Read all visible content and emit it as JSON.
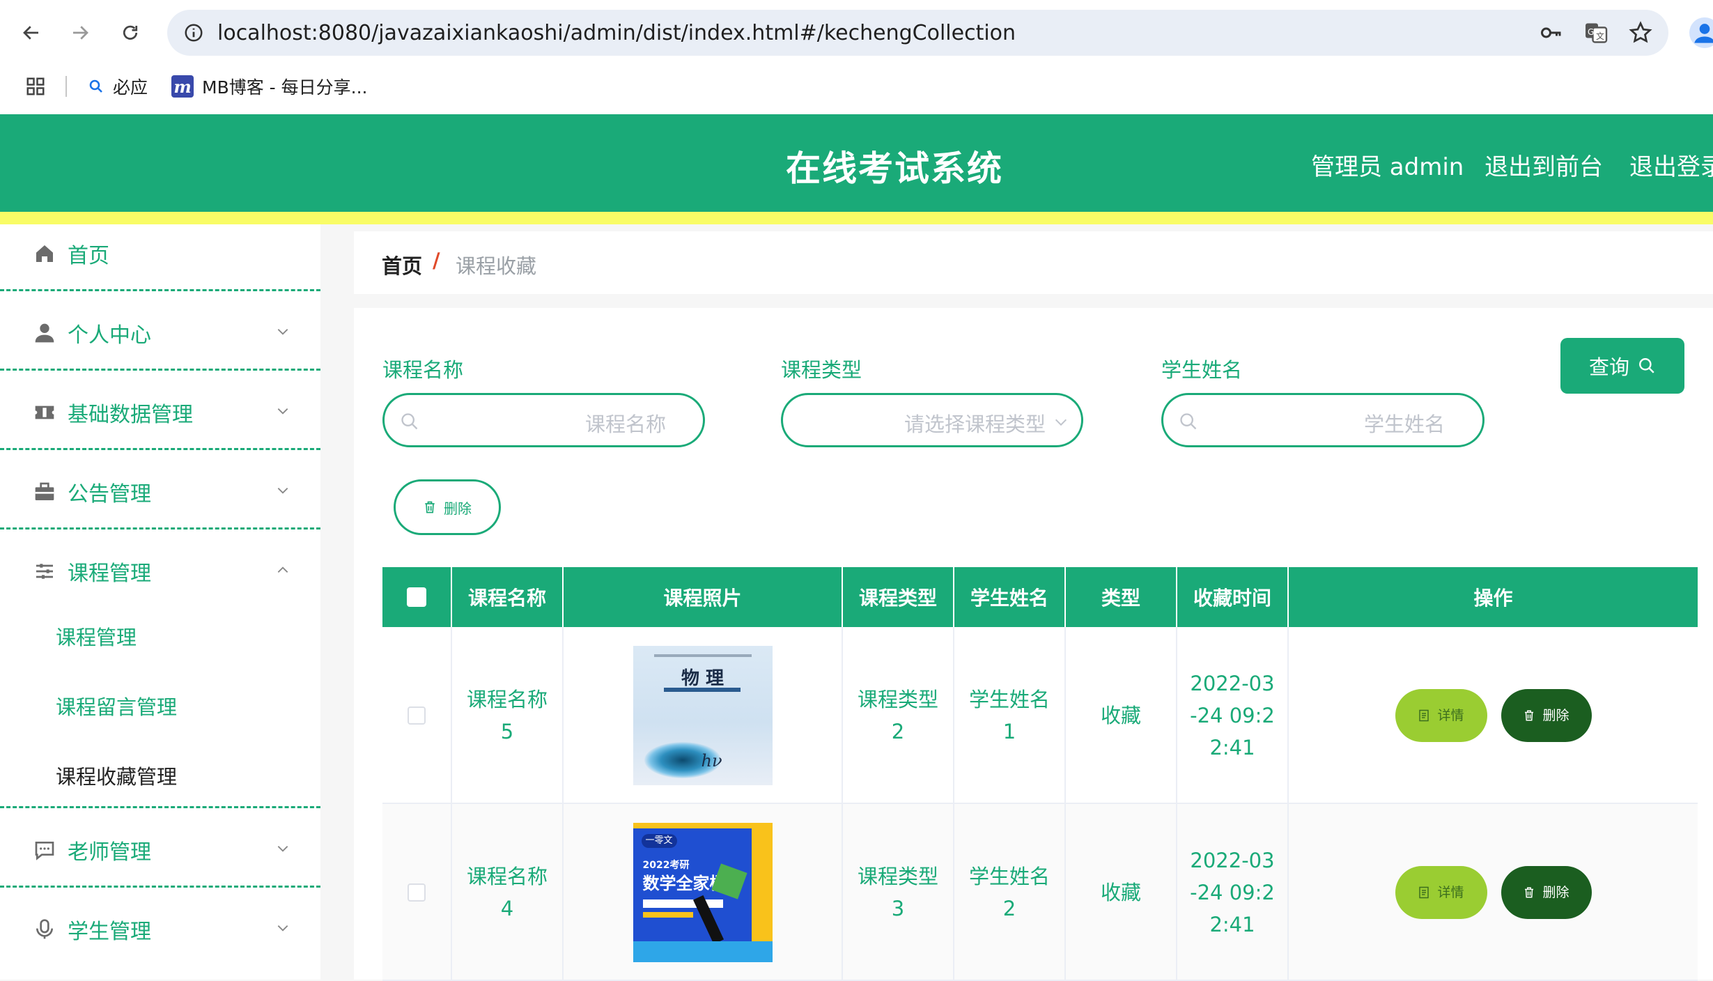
{
  "browser": {
    "url": "localhost:8080/javazaixiankaoshi/admin/dist/index.html#/kechengCollection",
    "bookmarks": [
      {
        "label": "必应",
        "icon": "search-icon"
      },
      {
        "label": "MB博客 - 每日分享...",
        "icon": "mb-logo-icon"
      }
    ]
  },
  "header": {
    "title": "在线考试系统",
    "user_label": "管理员 admin",
    "to_front_label": "退出到前台",
    "logout_label": "退出登录"
  },
  "colors": {
    "primary": "#1aaa78",
    "accent_line": "#f9fc66",
    "detail_button": "#9acd32",
    "delete_button": "#1b5e20"
  },
  "sidebar": {
    "items": [
      {
        "label": "首页",
        "icon": "home-icon"
      },
      {
        "label": "个人中心",
        "icon": "user-icon"
      },
      {
        "label": "基础数据管理",
        "icon": "ticket-icon"
      },
      {
        "label": "公告管理",
        "icon": "briefcase-icon"
      },
      {
        "label": "课程管理",
        "icon": "sliders-icon",
        "expanded": true,
        "children": [
          {
            "label": "课程管理"
          },
          {
            "label": "课程留言管理"
          },
          {
            "label": "课程收藏管理",
            "active": true
          }
        ]
      },
      {
        "label": "老师管理",
        "icon": "message-icon"
      },
      {
        "label": "学生管理",
        "icon": "microphone-icon"
      }
    ]
  },
  "breadcrumb": {
    "home": "首页",
    "separator": "/",
    "current": "课程收藏"
  },
  "filters": {
    "course_name": {
      "label": "课程名称",
      "placeholder": "课程名称"
    },
    "course_type": {
      "label": "课程类型",
      "placeholder": "请选择课程类型"
    },
    "student_name": {
      "label": "学生姓名",
      "placeholder": "学生姓名"
    },
    "query_label": "查询",
    "delete_label": "删除"
  },
  "table": {
    "headers": [
      "课程名称",
      "课程照片",
      "课程类型",
      "学生姓名",
      "类型",
      "收藏时间",
      "操作"
    ],
    "rows": [
      {
        "course_name": "课程名称5",
        "photo": {
          "title": "物 理",
          "icon": "physics-textbook-cover"
        },
        "course_type": "课程类型2",
        "student_name": "学生姓名1",
        "type": "收藏",
        "time": "2022-03-24 09:22:41",
        "detail_label": "详情",
        "delete_label": "删除"
      },
      {
        "course_name": "课程名称4",
        "photo": {
          "title": "数学全家桶",
          "subtitle": "2022考研",
          "brand": "一零文",
          "icon": "math-book-cover"
        },
        "course_type": "课程类型3",
        "student_name": "学生姓名2",
        "type": "收藏",
        "time": "2022-03-24 09:22:41",
        "detail_label": "详情",
        "delete_label": "删除"
      }
    ]
  }
}
